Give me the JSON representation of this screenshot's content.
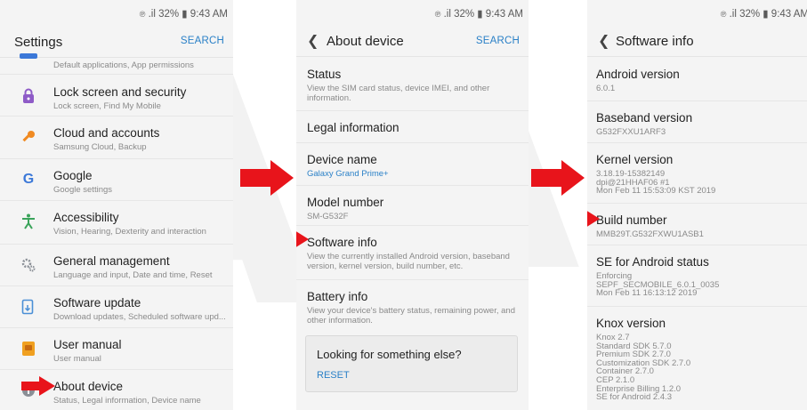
{
  "status_bar": {
    "text": " .  32% ▐ 9:43 AM"
  },
  "settings": {
    "title": "Settings",
    "search": "SEARCH",
    "partial_item": "Default applications, App permissions",
    "items": [
      {
        "title": "Lock screen and security",
        "subtitle": "Lock screen, Find My Mobile",
        "icon": "lock-icon",
        "color": "#8e5bc7"
      },
      {
        "title": "Cloud and accounts",
        "subtitle": "Samsung Cloud, Backup",
        "icon": "key-icon",
        "color": "#f08a22"
      },
      {
        "title": "Google",
        "subtitle": "Google settings",
        "icon": "google-icon",
        "color": "#3b78d8"
      },
      {
        "title": "Accessibility",
        "subtitle": "Vision, Hearing, Dexterity and interaction",
        "icon": "accessibility-icon",
        "color": "#3aa35a"
      },
      {
        "title": "General management",
        "subtitle": "Language and input, Date and time, Reset",
        "icon": "gears-icon",
        "color": "#8a8f96"
      },
      {
        "title": "Software update",
        "subtitle": "Download updates, Scheduled software upd...",
        "icon": "software-update-icon",
        "color": "#4a8fd6"
      },
      {
        "title": "User manual",
        "subtitle": "User manual",
        "icon": "user-manual-icon",
        "color": "#f0a020"
      },
      {
        "title": "About device",
        "subtitle": "Status, Legal information, Device name",
        "icon": "info-icon",
        "color": "#8a8f96"
      }
    ]
  },
  "about": {
    "title": "About device",
    "search": "SEARCH",
    "items": [
      {
        "title": "Status",
        "subtitle": "View the SIM card status, device IMEI, and other information."
      },
      {
        "title": "Legal information",
        "subtitle": ""
      },
      {
        "title": "Device name",
        "subtitle": "Galaxy Grand Prime+"
      },
      {
        "title": "Model number",
        "subtitle": "SM-G532F"
      },
      {
        "title": "Software info",
        "subtitle": "View the currently installed Android version, baseband version, kernel version, build number, etc."
      },
      {
        "title": "Battery info",
        "subtitle": "View your device's battery status, remaining power, and other information."
      }
    ],
    "card": {
      "title": "Looking for something else?",
      "action": "RESET"
    }
  },
  "software": {
    "title": "Software info",
    "items": [
      {
        "title": "Android version",
        "lines": [
          "6.0.1"
        ]
      },
      {
        "title": "Baseband version",
        "lines": [
          "G532FXXU1ARF3"
        ]
      },
      {
        "title": "Kernel version",
        "lines": [
          "3.18.19-15382149",
          "dpi@21HHAF06 #1",
          "Mon Feb 11 15:53:09 KST 2019"
        ]
      },
      {
        "title": "Build number",
        "lines": [
          "MMB29T.G532FXWU1ASB1"
        ]
      },
      {
        "title": "SE for Android status",
        "lines": [
          "Enforcing",
          "SEPF_SECMOBILE_6.0.1_0035",
          "Mon Feb 11 16:13:12 2019"
        ]
      },
      {
        "title": "Knox version",
        "lines": [
          "Knox 2.7",
          "Standard SDK 5.7.0",
          "Premium SDK 2.7.0",
          "Customization SDK 2.7.0",
          "Container 2.7.0",
          "CEP 2.1.0",
          "Enterprise Billing 1.2.0",
          "SE for Android 2.4.3"
        ]
      }
    ]
  },
  "colors": {
    "accent": "#2a80c7",
    "arrow": "#e8141b",
    "background": "#f4f4f4"
  }
}
